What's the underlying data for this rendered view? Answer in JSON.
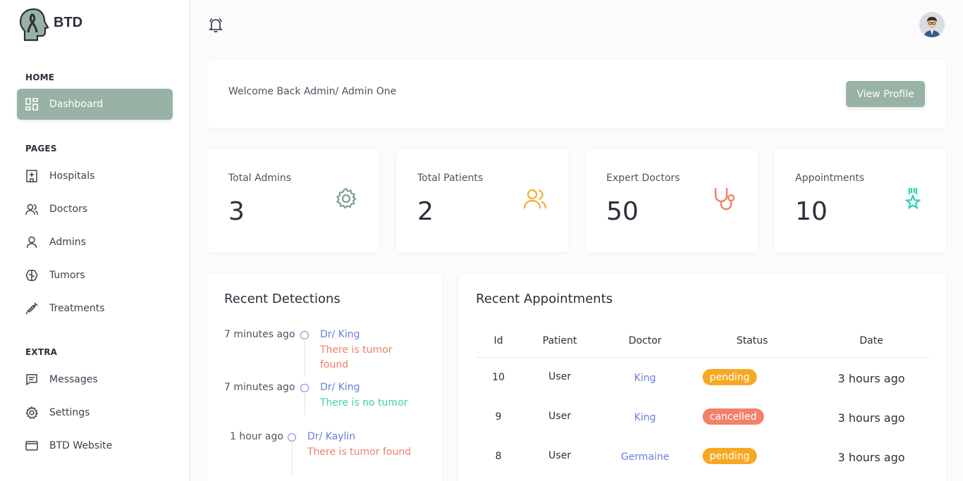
{
  "brand": {
    "name": "BTD"
  },
  "sidebar": {
    "sections": [
      {
        "label": "HOME"
      },
      {
        "label": "PAGES"
      },
      {
        "label": "EXTRA"
      }
    ],
    "items": [
      {
        "label": "Dashboard",
        "icon": "dashboard-icon",
        "active": true
      },
      {
        "label": "Hospitals",
        "icon": "hospital-icon"
      },
      {
        "label": "Doctors",
        "icon": "users-icon"
      },
      {
        "label": "Admins",
        "icon": "user-icon"
      },
      {
        "label": "Tumors",
        "icon": "brain-icon"
      },
      {
        "label": "Treatments",
        "icon": "syringe-icon"
      },
      {
        "label": "Messages",
        "icon": "message-icon"
      },
      {
        "label": "Settings",
        "icon": "gear-icon"
      },
      {
        "label": "BTD Website",
        "icon": "browser-icon"
      }
    ]
  },
  "header": {
    "bell_icon": "bell-icon",
    "avatar": "user-avatar"
  },
  "welcome": {
    "text": "Welcome Back Admin/ Admin One",
    "button": "View Profile"
  },
  "stats": [
    {
      "title": "Total Admins",
      "value": "3",
      "icon": "gear-icon",
      "color": "#7f9d90"
    },
    {
      "title": "Total Patients",
      "value": "2",
      "icon": "users-icon",
      "color": "#f6a93b"
    },
    {
      "title": "Expert Doctors",
      "value": "50",
      "icon": "stethoscope-icon",
      "color": "#f2806a"
    },
    {
      "title": "Appointments",
      "value": "10",
      "icon": "award-icon",
      "color": "#2ed3b0"
    }
  ],
  "detections": {
    "title": "Recent Detections",
    "items": [
      {
        "time": "7 minutes ago",
        "doctor": "Dr/ King",
        "result": "There is tumor found",
        "found": true
      },
      {
        "time": "7 minutes ago",
        "doctor": "Dr/ King",
        "result": "There is no tumor",
        "found": false
      },
      {
        "time": "1 hour ago",
        "doctor": "Dr/ Kaylin",
        "result": "There is tumor found",
        "found": true
      }
    ]
  },
  "appointments": {
    "title": "Recent Appointments",
    "columns": [
      "Id",
      "Patient",
      "Doctor",
      "Status",
      "Date"
    ],
    "rows": [
      {
        "id": "10",
        "patient": "User",
        "doctor": "King",
        "status": "pending",
        "date": "3 hours ago"
      },
      {
        "id": "9",
        "patient": "User",
        "doctor": "King",
        "status": "cancelled",
        "date": "3 hours ago"
      },
      {
        "id": "8",
        "patient": "User",
        "doctor": "Germaine",
        "status": "pending",
        "date": "3 hours ago"
      }
    ]
  },
  "colors": {
    "accent": "#98b2a6",
    "pending": "#f7a823",
    "cancelled": "#f2806a",
    "link": "#6c7ce0"
  }
}
